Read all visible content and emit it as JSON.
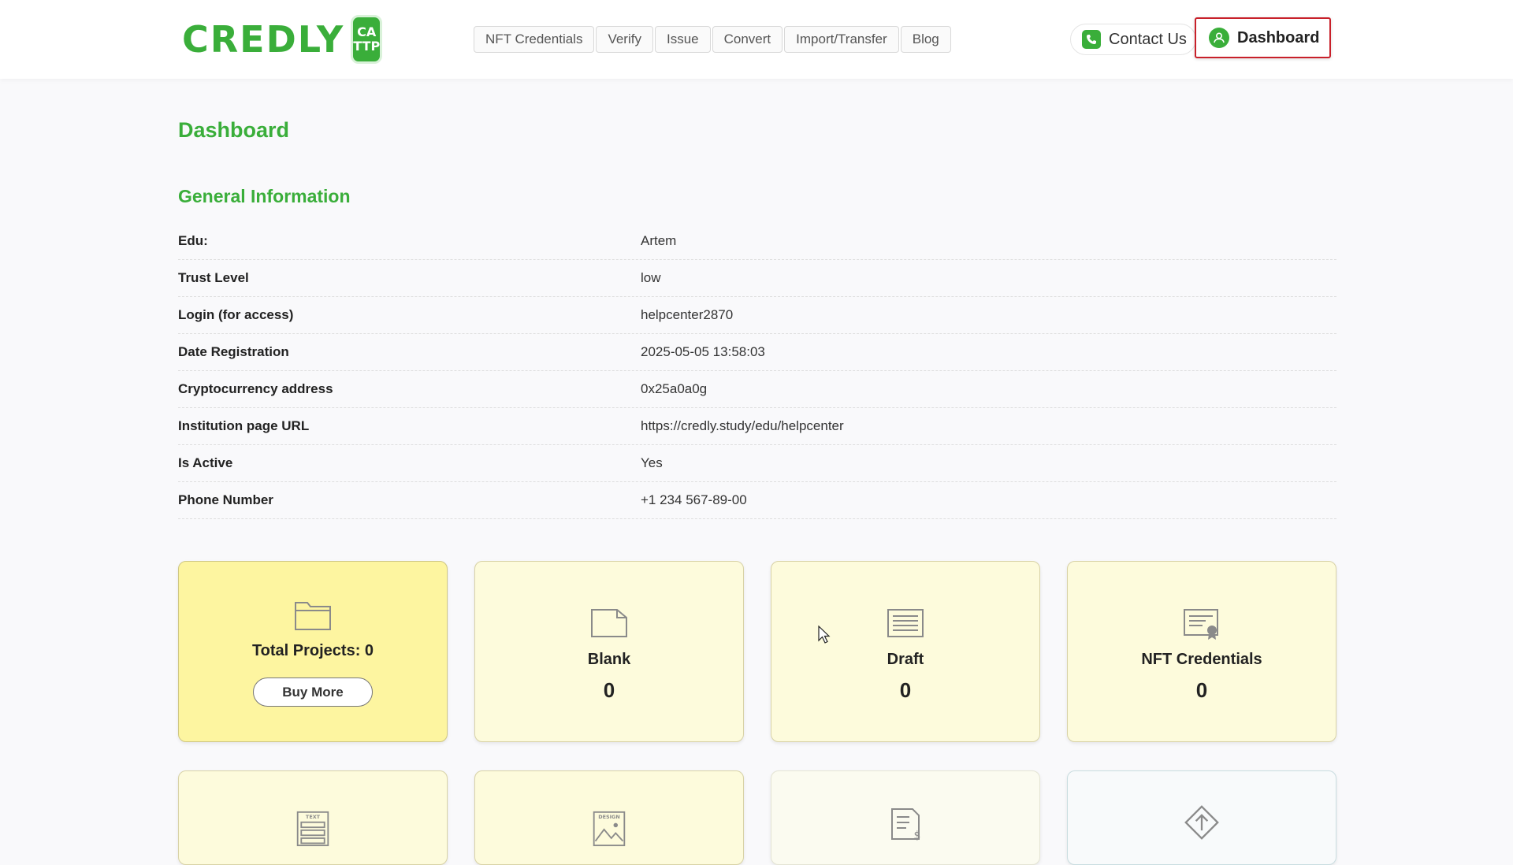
{
  "header": {
    "logo": {
      "text": "CREDLY",
      "badge_line1": "CA",
      "badge_line2": "TTP",
      "icon": "shield-check-icon"
    },
    "nav": [
      {
        "label": "NFT Credentials"
      },
      {
        "label": "Verify"
      },
      {
        "label": "Issue"
      },
      {
        "label": "Convert"
      },
      {
        "label": "Import/Transfer"
      },
      {
        "label": "Blog"
      }
    ],
    "contact_label": "Contact Us",
    "contact_icon": "phone-icon",
    "dashboard_label": "Dashboard",
    "dashboard_icon": "user-icon"
  },
  "page": {
    "title": "Dashboard",
    "section_title": "General Information"
  },
  "info": [
    {
      "label": "Edu:",
      "value": "Artem"
    },
    {
      "label": "Trust Level",
      "value": "low"
    },
    {
      "label": "Login (for access)",
      "value": "helpcenter2870"
    },
    {
      "label": "Date Registration",
      "value": "2025-05-05 13:58:03"
    },
    {
      "label": "Cryptocurrency address",
      "value": "0x25a0a0g"
    },
    {
      "label": "Institution page URL",
      "value": "https://credly.study/edu/helpcenter"
    },
    {
      "label": "Is Active",
      "value": "Yes"
    },
    {
      "label": "Phone Number",
      "value": "+1 234 567-89-00"
    }
  ],
  "cards": {
    "total": {
      "label": "Total Projects: 0",
      "button": "Buy More",
      "icon": "folder-icon"
    },
    "blank": {
      "label": "Blank",
      "count": "0",
      "icon": "blank-folder-icon"
    },
    "draft": {
      "label": "Draft",
      "count": "0",
      "icon": "document-lines-icon"
    },
    "nft": {
      "label": "NFT Credentials",
      "count": "0",
      "icon": "certificate-icon"
    },
    "bottom": [
      {
        "icon": "text-template-icon",
        "icon_text": "TEXT"
      },
      {
        "icon": "design-image-icon",
        "icon_text": "DESIGN"
      },
      {
        "icon": "invoice-icon"
      },
      {
        "icon": "upload-diamond-icon"
      }
    ]
  },
  "colors": {
    "brand_green": "#3aae3a",
    "card_yellow": "#fdfbdc",
    "card_highlight": "#fdf5a0",
    "active_border": "#c8202a"
  }
}
